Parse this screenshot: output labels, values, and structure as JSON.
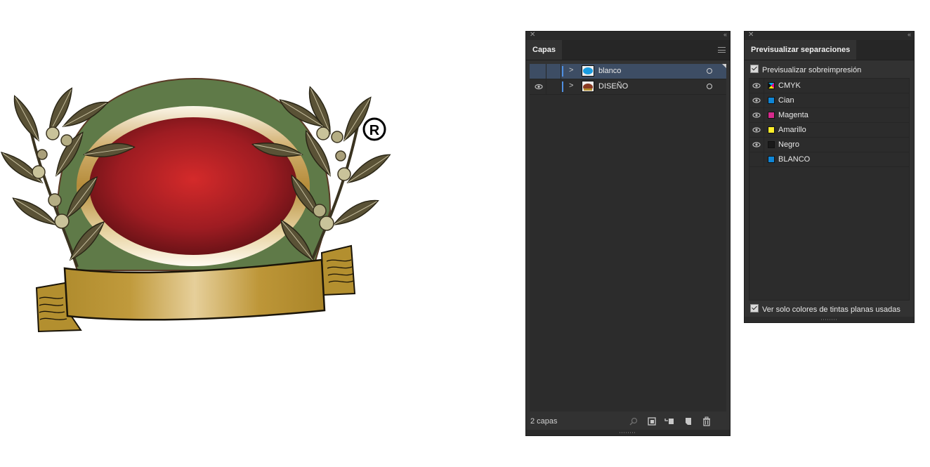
{
  "layers_panel": {
    "tab_label": "Capas",
    "layers": [
      {
        "name": "blanco",
        "visible": false,
        "selected": true,
        "thumb": "blue-shape"
      },
      {
        "name": "DISEÑO",
        "visible": true,
        "selected": false,
        "thumb": "brown-shape"
      }
    ],
    "count_label": "2 capas"
  },
  "separations_panel": {
    "tab_label": "Previsualizar separaciones",
    "overprint_label": "Previsualizar sobreimpresión",
    "inks": [
      {
        "name": "CMYK",
        "visible": true,
        "swatch": "cmyk"
      },
      {
        "name": "Cian",
        "visible": true,
        "swatch": "#0f86d6"
      },
      {
        "name": "Magenta",
        "visible": true,
        "swatch": "#d62a8c"
      },
      {
        "name": "Amarillo",
        "visible": true,
        "swatch": "#ffef2a"
      },
      {
        "name": "Negro",
        "visible": true,
        "swatch": "#1a1a1a"
      },
      {
        "name": "BLANCO",
        "visible": false,
        "swatch": "#0f86d6"
      }
    ],
    "spot_only_label": "Ver solo colores de tintas planas usadas"
  },
  "artwork": {
    "registered_mark": "®"
  }
}
